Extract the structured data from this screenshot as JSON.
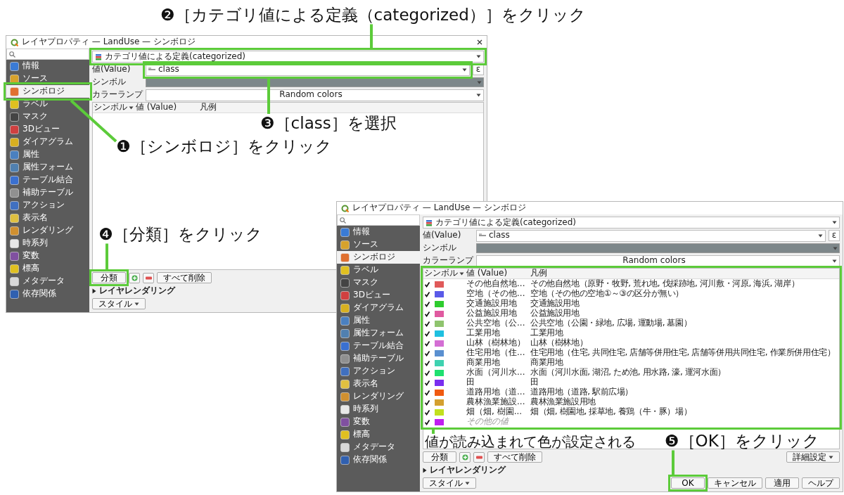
{
  "windows": [
    {
      "title": "レイヤプロパティ — LandUse — シンボロジ",
      "closable": true,
      "sidebar": {
        "items": [
          {
            "label": "情報",
            "selected": false
          },
          {
            "label": "ソース",
            "selected": false
          },
          {
            "label": "シンボロジ",
            "selected": true,
            "callout": "❶［シンボロジ］をクリック"
          },
          {
            "label": "ラベル",
            "selected": false
          },
          {
            "label": "マスク",
            "selected": false
          },
          {
            "label": "3Dビュー",
            "selected": false
          },
          {
            "label": "ダイアグラム",
            "selected": false
          },
          {
            "label": "属性",
            "selected": false
          },
          {
            "label": "属性フォーム",
            "selected": false
          },
          {
            "label": "テーブル結合",
            "selected": false
          },
          {
            "label": "補助テーブル",
            "selected": false
          },
          {
            "label": "アクション",
            "selected": false
          },
          {
            "label": "表示名",
            "selected": false
          },
          {
            "label": "レンダリング",
            "selected": false
          },
          {
            "label": "時系列",
            "selected": false
          },
          {
            "label": "変数",
            "selected": false
          },
          {
            "label": "標高",
            "selected": false
          },
          {
            "label": "メタデータ",
            "selected": false
          },
          {
            "label": "依存関係",
            "selected": false
          }
        ]
      },
      "renderer": {
        "value": "カテゴリ値による定義(categorized)",
        "callout": "❷［カテゴリ値による定義（categorized）］をクリック"
      },
      "value_label": "値(Value)",
      "value_field": {
        "value": "class",
        "callout": "❸［class］を選択"
      },
      "expression_button": "ε",
      "symbol_label": "シンボル",
      "color_ramp_label": "カラーランプ",
      "color_ramp": "Random colors",
      "columns": [
        "シンボル",
        "値 (Value)",
        "凡例"
      ],
      "buttons": [
        {
          "kind": "text",
          "label": "分類",
          "callout": "❹［分類］をクリック"
        },
        {
          "kind": "add"
        },
        {
          "kind": "remove"
        },
        {
          "kind": "text",
          "label": "すべて削除"
        }
      ],
      "layer_rendering": "レイヤレンダリング",
      "style_button": "スタイル"
    },
    {
      "title": "レイヤプロパティ — LandUse — シンボロジ",
      "closable": false,
      "sidebar": {
        "items": [
          {
            "label": "情報",
            "selected": false
          },
          {
            "label": "ソース",
            "selected": false
          },
          {
            "label": "シンボロジ",
            "selected": true
          },
          {
            "label": "ラベル",
            "selected": false
          },
          {
            "label": "マスク",
            "selected": false
          },
          {
            "label": "3Dビュー",
            "selected": false
          },
          {
            "label": "ダイアグラム",
            "selected": false
          },
          {
            "label": "属性",
            "selected": false
          },
          {
            "label": "属性フォーム",
            "selected": false
          },
          {
            "label": "テーブル結合",
            "selected": false
          },
          {
            "label": "補助テーブル",
            "selected": false
          },
          {
            "label": "アクション",
            "selected": false
          },
          {
            "label": "表示名",
            "selected": false
          },
          {
            "label": "レンダリング",
            "selected": false
          },
          {
            "label": "時系列",
            "selected": false
          },
          {
            "label": "変数",
            "selected": false
          },
          {
            "label": "標高",
            "selected": false
          },
          {
            "label": "メタデータ",
            "selected": false
          },
          {
            "label": "依存関係",
            "selected": false
          }
        ]
      },
      "renderer": {
        "value": "カテゴリ値による定義(categorized)"
      },
      "value_label": "値(Value)",
      "value_field": {
        "value": "class"
      },
      "expression_button": "ε",
      "symbol_label": "シンボル",
      "color_ramp_label": "カラーランプ",
      "color_ramp": "Random colors",
      "columns": [
        "シンボル",
        "値 (Value)",
        "凡例"
      ],
      "rows": [
        {
          "kind": "category",
          "checked": true,
          "color": "#e05a5a",
          "value": "その他自然地...",
          "legend": "その他自然地（原野・牧野, 荒れ地, 伐採跡地, 河川敷・河原, 海浜, 湖岸）"
        },
        {
          "kind": "category",
          "checked": true,
          "color": "#5a5ae8",
          "value": "空地（その他...",
          "legend": "空地（その他の空地①～③の区分が無い）"
        },
        {
          "kind": "category",
          "checked": true,
          "color": "#2ecc2e",
          "value": "交通施設用地",
          "legend": "交通施設用地"
        },
        {
          "kind": "category",
          "checked": true,
          "color": "#e05aa0",
          "value": "公益施設用地",
          "legend": "公益施設用地"
        },
        {
          "kind": "category",
          "checked": true,
          "color": "#8fc46e",
          "value": "公共空地（公...",
          "legend": "公共空地（公園・緑地, 広場, 運動場, 墓園）"
        },
        {
          "kind": "category",
          "checked": true,
          "color": "#1ec0e0",
          "value": "工業用地",
          "legend": "工業用地"
        },
        {
          "kind": "category",
          "checked": true,
          "color": "#d46ed4",
          "value": "山林（樹林地）",
          "legend": "山林（樹林地）"
        },
        {
          "kind": "category",
          "checked": true,
          "color": "#5a90d0",
          "value": "住宅用地（住...",
          "legend": "住宅用地（住宅, 共同住宅, 店舗等併用住宅, 店舗等併用共同住宅, 作業所併用住宅）"
        },
        {
          "kind": "category",
          "checked": true,
          "color": "#3ed2b0",
          "value": "商業用地",
          "legend": "商業用地"
        },
        {
          "kind": "category",
          "checked": true,
          "color": "#1ee070",
          "value": "水面（河川水...",
          "legend": "水面（河川水面, 湖沼, ため池, 用水路, 濠, 運河水面）"
        },
        {
          "kind": "category",
          "checked": true,
          "color": "#7a2ef0",
          "value": "田",
          "legend": "田"
        },
        {
          "kind": "category",
          "checked": true,
          "color": "#f05a10",
          "value": "道路用地（道...",
          "legend": "道路用地（道路, 駅前広場）"
        },
        {
          "kind": "category",
          "checked": true,
          "color": "#d4a030",
          "value": "農林漁業施設...",
          "legend": "農林漁業施設用地"
        },
        {
          "kind": "category",
          "checked": true,
          "color": "#c2e01e",
          "value": "畑（畑, 樹園...",
          "legend": "畑（畑, 樹園地, 採草地, 養鶏（牛・豚）場）"
        },
        {
          "kind": "other",
          "checked": true,
          "color": "#c01ef0",
          "value": "その他の値"
        }
      ],
      "rows_note": "値が読み込まれて色が設定される",
      "buttons": [
        {
          "kind": "text",
          "label": "分類"
        },
        {
          "kind": "add"
        },
        {
          "kind": "remove"
        },
        {
          "kind": "text",
          "label": "すべて削除"
        }
      ],
      "advanced_button": "詳細設定",
      "layer_rendering": "レイヤレンダリング",
      "style_button": "スタイル",
      "dialog_buttons": [
        {
          "label": "OK",
          "callout": "❺［OK］をクリック"
        },
        {
          "label": "キャンセル"
        },
        {
          "label": "適用"
        },
        {
          "label": "ヘルプ"
        }
      ]
    }
  ]
}
